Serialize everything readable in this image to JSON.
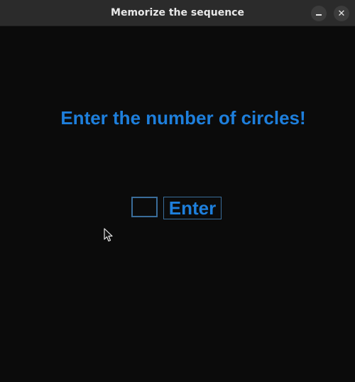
{
  "window": {
    "title": "Memorize the sequence",
    "minimize_icon": "minimize-icon",
    "close_icon": "close-icon",
    "close_glyph": "✕"
  },
  "main": {
    "prompt": "Enter the number of circles!",
    "entry_value": "",
    "enter_button_label": "Enter"
  },
  "colors": {
    "background": "#0b0b0b",
    "accent": "#1e7fdc",
    "border": "#3a6d9a",
    "titlebar": "#2b2b2b"
  }
}
